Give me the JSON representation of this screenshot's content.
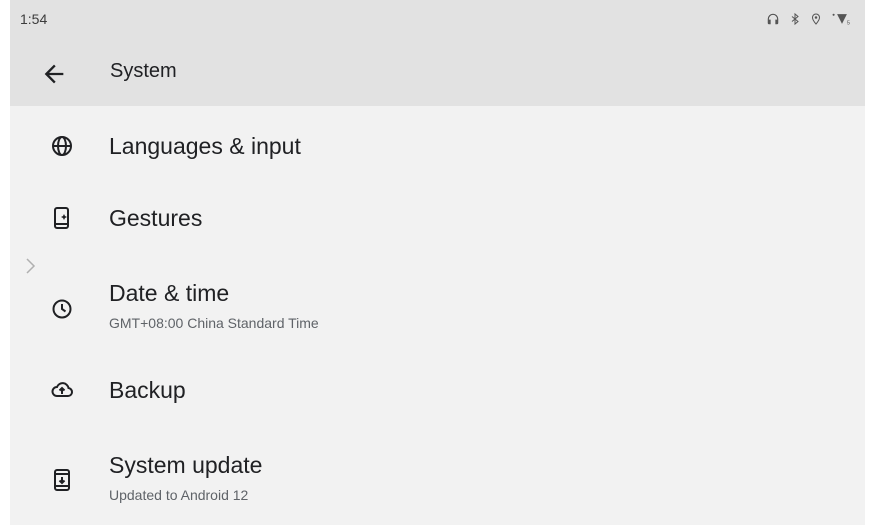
{
  "status_bar": {
    "time": "1:54",
    "icons": [
      "headset-icon",
      "bluetooth-icon",
      "location-icon",
      "wifi-icon"
    ]
  },
  "app_bar": {
    "back_icon": "arrow-back-icon",
    "title": "System"
  },
  "items": [
    {
      "label": "Languages & input",
      "icon": "globe-icon"
    },
    {
      "label": "Gestures",
      "icon": "gesture-phone-icon"
    },
    {
      "label": "Date & time",
      "subtitle": "GMT+08:00 China Standard Time",
      "icon": "clock-icon"
    },
    {
      "label": "Backup",
      "icon": "cloud-upload-icon"
    },
    {
      "label": "System update",
      "subtitle": "Updated to Android 12",
      "icon": "system-update-icon"
    }
  ],
  "colors": {
    "background": "#f2f2f2",
    "bar": "#e2e2e2",
    "primary_text": "#202124",
    "secondary_text": "#5f6368"
  }
}
